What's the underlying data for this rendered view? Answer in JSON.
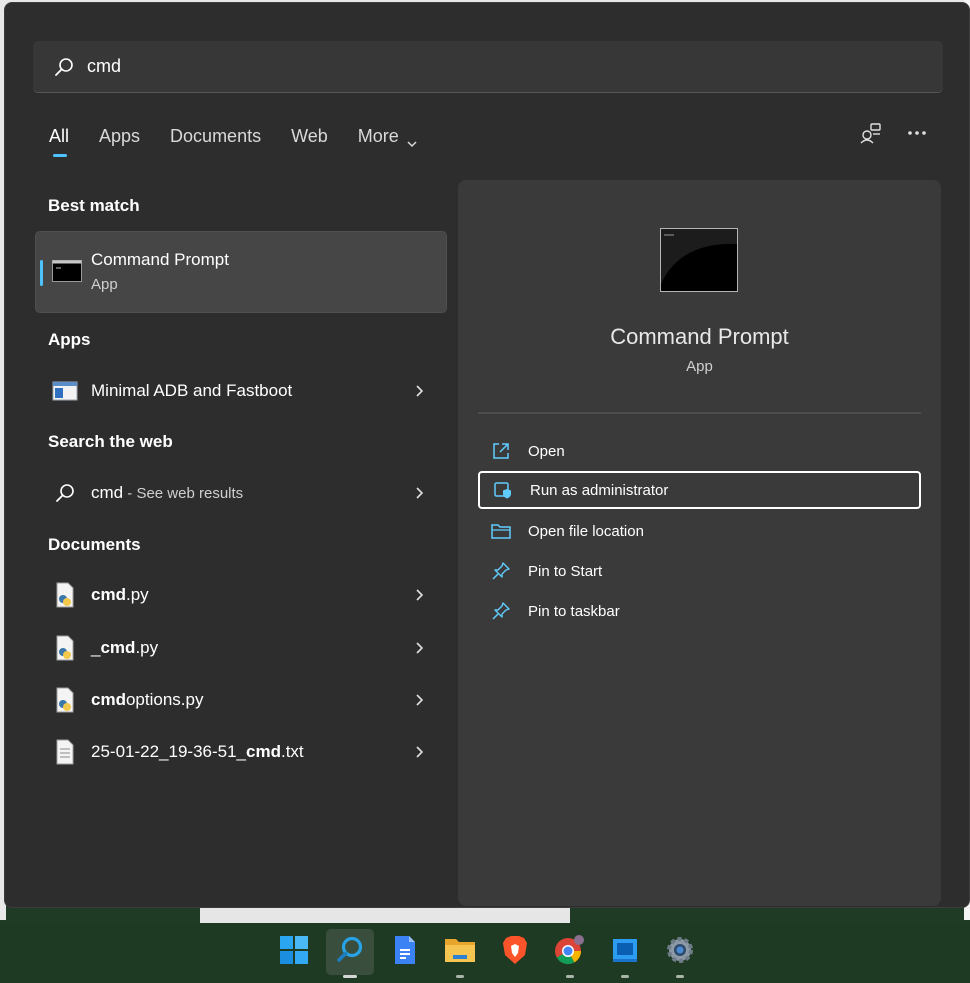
{
  "search": {
    "query": "cmd"
  },
  "tabs": [
    {
      "label": "All",
      "active": true
    },
    {
      "label": "Apps"
    },
    {
      "label": "Documents"
    },
    {
      "label": "Web"
    },
    {
      "label": "More"
    }
  ],
  "toolbar_icons": [
    "connected-accounts-icon",
    "more-options-icon"
  ],
  "best_match": {
    "heading": "Best match",
    "title": "Command Prompt",
    "subtitle": "App"
  },
  "apps": {
    "heading": "Apps",
    "items": [
      {
        "label": "Minimal ADB and Fastboot"
      }
    ]
  },
  "web": {
    "heading": "Search the web",
    "query": "cmd",
    "suffix": " - See web results"
  },
  "documents": {
    "heading": "Documents",
    "items": [
      {
        "pre": "",
        "bold": "cmd",
        "post": ".py",
        "icon": "python-file-icon"
      },
      {
        "pre": "_",
        "bold": "cmd",
        "post": ".py",
        "icon": "python-file-icon"
      },
      {
        "pre": "",
        "bold": "cmd",
        "post": "options.py",
        "icon": "python-file-icon"
      },
      {
        "pre": "25-01-22_19-36-51_",
        "bold": "cmd",
        "post": ".txt",
        "icon": "text-file-icon"
      }
    ]
  },
  "detail": {
    "title": "Command Prompt",
    "subtitle": "App",
    "actions": [
      {
        "label": "Open",
        "icon": "open-external-icon"
      },
      {
        "label": "Run as administrator",
        "icon": "admin-shield-icon",
        "focused": true
      },
      {
        "label": "Open file location",
        "icon": "folder-icon"
      },
      {
        "label": "Pin to Start",
        "icon": "pin-icon"
      },
      {
        "label": "Pin to taskbar",
        "icon": "pin-icon"
      }
    ]
  },
  "taskbar": {
    "items": [
      "windows-start-icon",
      "search-icon",
      "google-docs-icon",
      "file-explorer-icon",
      "brave-browser-icon",
      "chrome-icon",
      "windows-store-icon",
      "settings-icon"
    ],
    "active": "search-icon"
  },
  "colors": {
    "accent": "#4cc2ff",
    "panel": "#2d2d2d",
    "detail_pane": "#3a3a3a",
    "taskbar": "#1e3a23"
  }
}
